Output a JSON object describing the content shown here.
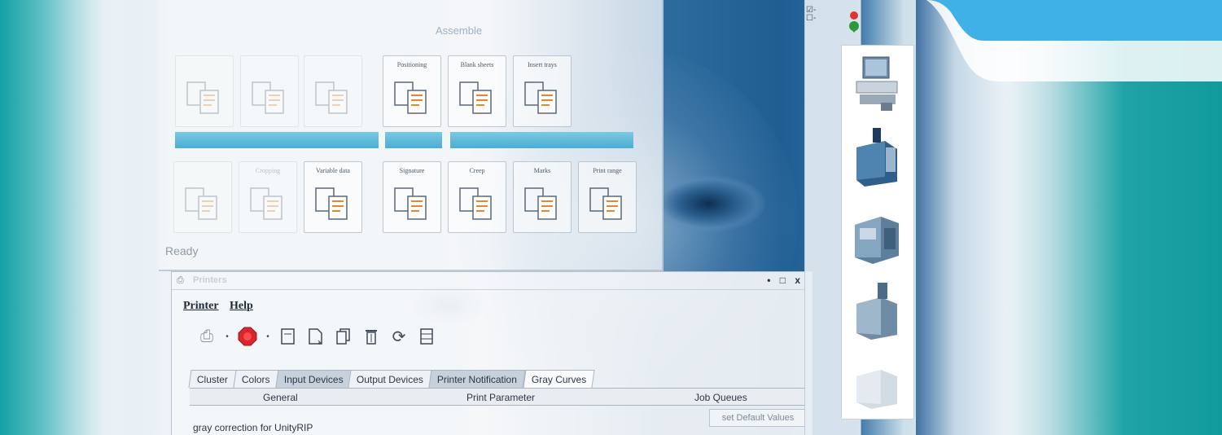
{
  "workflow": {
    "section_headers": [
      "Assemble"
    ],
    "cards_row1": [
      {
        "label": "",
        "faded": true
      },
      {
        "label": "",
        "faded": true
      },
      {
        "label": "",
        "faded": true
      },
      {
        "label": "Positioning",
        "faded": false
      },
      {
        "label": "Blank sheets",
        "faded": false
      },
      {
        "label": "Insert trays",
        "faded": false
      }
    ],
    "cards_row2": [
      {
        "label": "",
        "faded": true
      },
      {
        "label": "Cropping",
        "faded": true
      },
      {
        "label": "Variable data",
        "faded": false
      },
      {
        "label": "Signature",
        "faded": false
      },
      {
        "label": "Creep",
        "faded": false
      },
      {
        "label": "Marks",
        "faded": false
      },
      {
        "label": "Print range",
        "faded": false
      }
    ],
    "status": "Ready"
  },
  "printer_window": {
    "title": "Printers",
    "window_controls": "• □ x",
    "menu": [
      "Printer",
      "Help"
    ],
    "tabs": [
      {
        "label": "Cluster",
        "state": "normal"
      },
      {
        "label": "Colors",
        "state": "normal"
      },
      {
        "label": "Input Devices",
        "state": "active"
      },
      {
        "label": "Output Devices",
        "state": "normal"
      },
      {
        "label": "Printer Notification",
        "state": "active"
      },
      {
        "label": "Gray Curves",
        "state": "selected"
      }
    ],
    "subtabs": {
      "general": "General",
      "print_parameter": "Print Parameter",
      "job_queues": "Job Queues"
    },
    "set_default_button": "set Default Values",
    "gray_correction_label": "gray correction for UnityRIP"
  },
  "colors": {
    "banner": "#3fb1e6",
    "accent_bar": "#4aafd6",
    "stop_red": "#d8262a"
  }
}
